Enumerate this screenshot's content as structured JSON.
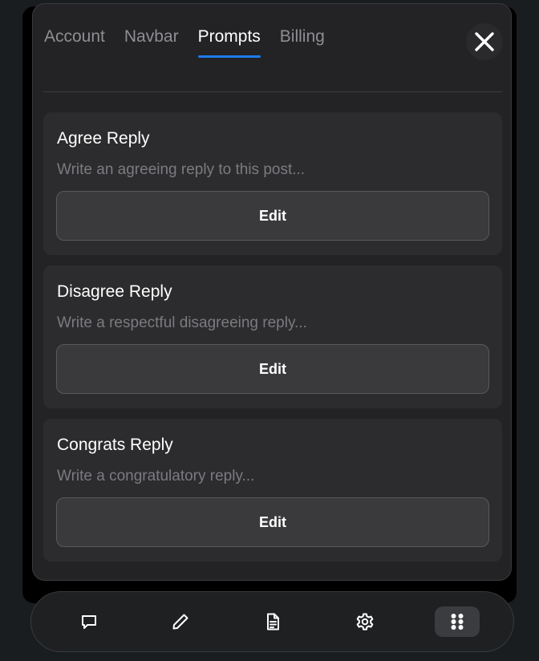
{
  "tabs": [
    {
      "label": "Account",
      "active": false
    },
    {
      "label": "Navbar",
      "active": false
    },
    {
      "label": "Prompts",
      "active": true
    },
    {
      "label": "Billing",
      "active": false
    }
  ],
  "close_icon": "close-icon",
  "prompts": [
    {
      "title": "Agree Reply",
      "description": "Write an agreeing reply to this post...",
      "button": "Edit"
    },
    {
      "title": "Disagree Reply",
      "description": "Write a respectful disagreeing reply...",
      "button": "Edit"
    },
    {
      "title": "Congrats Reply",
      "description": "Write a congratulatory reply...",
      "button": "Edit"
    }
  ],
  "bottom_nav": [
    {
      "icon": "message-icon",
      "active": false
    },
    {
      "icon": "pencil-icon",
      "active": false
    },
    {
      "icon": "document-icon",
      "active": false
    },
    {
      "icon": "gear-icon",
      "active": false
    },
    {
      "icon": "grid-dots-icon",
      "active": true
    }
  ],
  "colors": {
    "accent": "#1d7cf2",
    "panel_bg": "#232325",
    "card_bg": "#2c2c2e",
    "button_bg": "#3a3a3c"
  }
}
